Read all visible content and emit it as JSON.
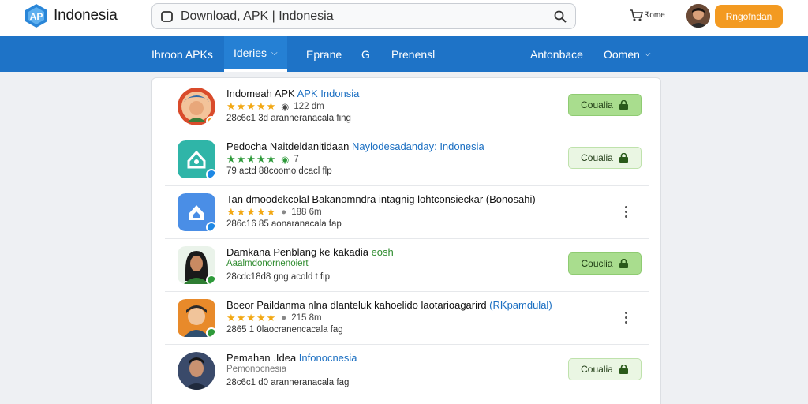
{
  "header": {
    "logo_text": "Indonesia",
    "search_text": "Download, APK | Indonesia",
    "cart_label": "₹ome",
    "cta_label": "Rngofndan"
  },
  "nav": {
    "items": [
      {
        "label": "Ihroon APKs",
        "chevron": false
      },
      {
        "label": "Ideries",
        "chevron": true
      },
      {
        "label": "Eprane",
        "chevron": false
      },
      {
        "label": "G",
        "chevron": false
      },
      {
        "label": "Prenensl",
        "chevron": false
      },
      {
        "label": "Antonbace",
        "chevron": false
      },
      {
        "label": "Oomen",
        "chevron": true
      }
    ]
  },
  "apps": [
    {
      "title": "Indomeah APK",
      "title_hl": " APK Indonsia",
      "stars": "★★★★★",
      "rating_text": "122 dm",
      "desc": "28c6c1 3d aranneranacala fing",
      "action": "download",
      "action_label": "Coualia",
      "icon": "profile-illustration-icon",
      "colors": {
        "icon_bg": "#d94b2b",
        "badge": "#f39a21"
      }
    },
    {
      "title": "Pedocha Naitdeldanitidaan",
      "title_hl": " Naylodesadanday: Indonesia",
      "stars": "★★★★★",
      "rating_text": "7",
      "desc": "79 actd 88coomo dcacl flp",
      "action": "download",
      "action_label": "Coualia",
      "icon": "teal-house-icon",
      "colors": {
        "icon_bg": "#2fb5a8",
        "badge": "#1e88e5"
      }
    },
    {
      "title": "Tan dmoodekcolal Bakanomndra  intagnig lohtconsieckar (Bonosahi)",
      "title_hl": "",
      "stars": "★★★★★",
      "rating_text": "188 6m",
      "desc": "286c16 85 aonaranacala fap",
      "action": "more",
      "action_label": "",
      "icon": "blue-house-icon",
      "colors": {
        "icon_bg": "#4a8ee6",
        "badge": "#1e88e5"
      }
    },
    {
      "title": "Damkana Penblang ke kakadia",
      "title_hl": " eosh",
      "stars": "",
      "rating_text": "Aaalmdonornenoiert",
      "desc": "28cdc18d8 gng acold t fip",
      "action": "download",
      "action_label": "Couclia",
      "icon": "woman-avatar-icon",
      "colors": {
        "icon_bg": "#2e7d32",
        "badge": "#2e9a3a"
      }
    },
    {
      "title": "Boeor Paildanma nlna dlanteluk kahoelido laotarioagarird",
      "title_hl": " (RKpamdulal)",
      "stars": "★★★★★",
      "rating_text": "215 8m",
      "desc": "2865 1 0laocranencacala fag",
      "action": "more",
      "action_label": "",
      "icon": "cartoon-man-icon",
      "colors": {
        "icon_bg": "#e88a2a",
        "badge": "#2e9a3a"
      }
    },
    {
      "title": "Pemahan .Idea",
      "title_hl": " Infonocnesia",
      "stars": "",
      "rating_text": "Pemonocnesia",
      "desc": "28c6c1 d0 aranneranacala fag",
      "action": "download",
      "action_label": "Coualia",
      "icon": "man-portrait-icon",
      "colors": {
        "icon_bg": "#3a4a6a",
        "badge": "#2e9a3a"
      }
    }
  ]
}
